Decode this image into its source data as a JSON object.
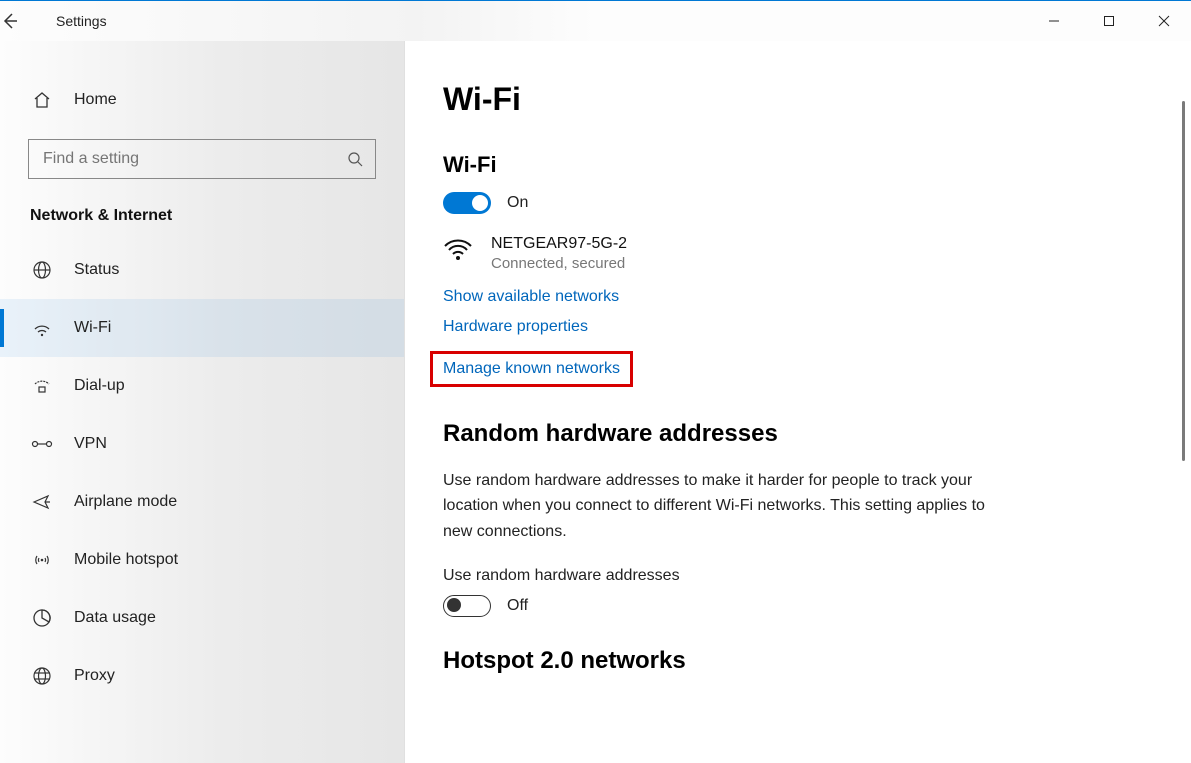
{
  "window": {
    "title": "Settings"
  },
  "sidebar": {
    "home": "Home",
    "search_placeholder": "Find a setting",
    "category": "Network & Internet",
    "items": [
      {
        "label": "Status"
      },
      {
        "label": "Wi-Fi"
      },
      {
        "label": "Dial-up"
      },
      {
        "label": "VPN"
      },
      {
        "label": "Airplane mode"
      },
      {
        "label": "Mobile hotspot"
      },
      {
        "label": "Data usage"
      },
      {
        "label": "Proxy"
      }
    ],
    "selected_index": 1
  },
  "main": {
    "page_title": "Wi-Fi",
    "wifi_section_title": "Wi-Fi",
    "wifi_toggle_state": "On",
    "connected_network": {
      "ssid": "NETGEAR97-5G-2",
      "status": "Connected, secured"
    },
    "links": {
      "show_available": "Show available networks",
      "hardware_props": "Hardware properties",
      "manage_known": "Manage known networks"
    },
    "random_section_title": "Random hardware addresses",
    "random_body": "Use random hardware addresses to make it harder for people to track your location when you connect to different Wi-Fi networks. This setting applies to new connections.",
    "random_sublabel": "Use random hardware addresses",
    "random_toggle_state": "Off",
    "hotspot_section_title": "Hotspot 2.0 networks"
  }
}
